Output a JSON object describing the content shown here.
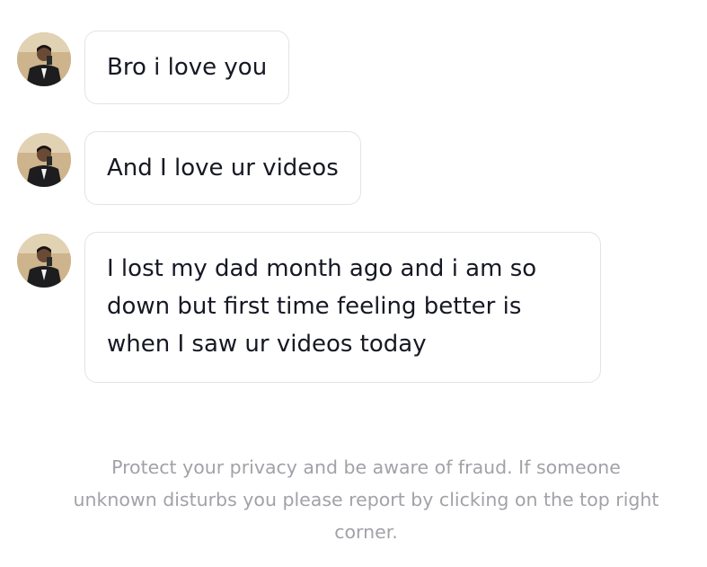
{
  "messages": [
    {
      "text": "Bro i love you"
    },
    {
      "text": "And I love ur videos"
    },
    {
      "text": "I lost my dad month ago and i am so down but first time feeling better is when I saw ur videos today"
    }
  ],
  "notice": "Protect your privacy and be aware of fraud. If someone unknown disturbs you please report by clicking on the top right corner.",
  "colors": {
    "bubble_border": "#e3e3e3",
    "message_text": "#161823",
    "notice_text": "#a1a2a7"
  }
}
